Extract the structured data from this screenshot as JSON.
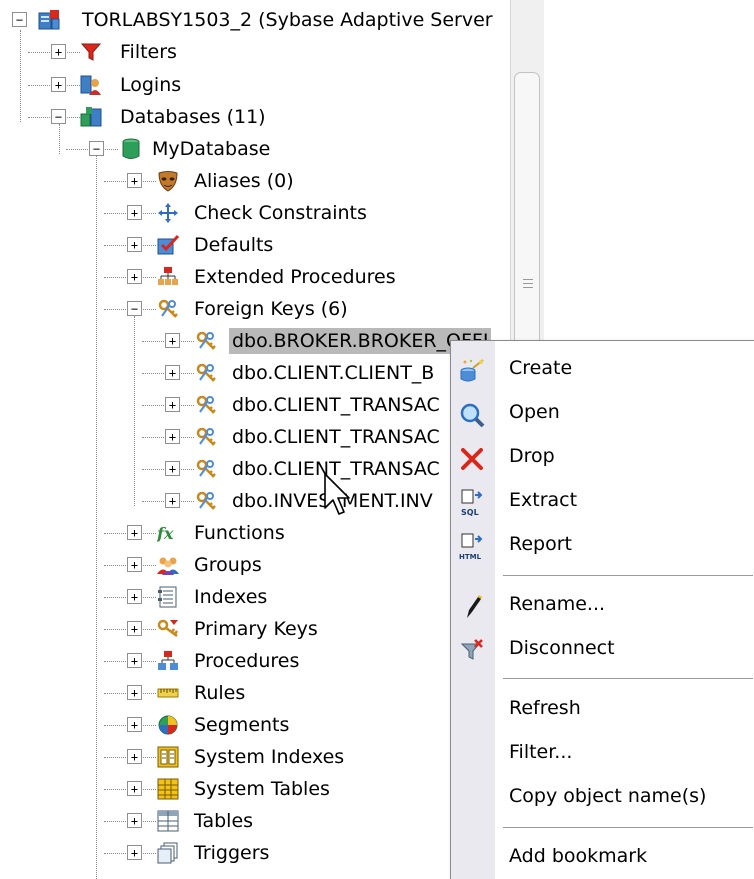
{
  "tree": {
    "server": "TORLABSY1503_2 (Sybase Adaptive Server",
    "filters": "Filters",
    "logins": "Logins",
    "databases": "Databases (11)",
    "mydatabase": "MyDatabase",
    "items": [
      {
        "label": "Aliases (0)",
        "icon": "mask-icon"
      },
      {
        "label": "Check Constraints",
        "icon": "move-arrows-icon"
      },
      {
        "label": "Defaults",
        "icon": "checkbox-icon"
      },
      {
        "label": "Extended Procedures",
        "icon": "hierarchy-icon"
      },
      {
        "label": "Foreign Keys (6)",
        "icon": "keys-icon"
      }
    ],
    "foreign_keys": [
      "dbo.BROKER.BROKER_OFFI",
      "dbo.CLIENT.CLIENT_B",
      "dbo.CLIENT_TRANSAC",
      "dbo.CLIENT_TRANSAC",
      "dbo.CLIENT_TRANSAC",
      "dbo.INVESTMENT.INV"
    ],
    "items_after": [
      {
        "label": "Functions",
        "icon": "function-icon"
      },
      {
        "label": "Groups",
        "icon": "group-icon"
      },
      {
        "label": "Indexes",
        "icon": "index-icon"
      },
      {
        "label": "Primary Keys",
        "icon": "primary-key-icon"
      },
      {
        "label": "Procedures",
        "icon": "procedure-icon"
      },
      {
        "label": "Rules",
        "icon": "ruler-icon"
      },
      {
        "label": "Segments",
        "icon": "segment-icon"
      },
      {
        "label": "System Indexes",
        "icon": "system-index-icon"
      },
      {
        "label": "System Tables",
        "icon": "system-table-icon"
      },
      {
        "label": "Tables",
        "icon": "table-icon"
      },
      {
        "label": "Triggers",
        "icon": "trigger-icon"
      }
    ]
  },
  "context_menu": {
    "items": [
      {
        "label": "Create",
        "icon": "create-icon"
      },
      {
        "label": "Open",
        "icon": "open-magnifier-icon"
      },
      {
        "label": "Drop",
        "icon": "drop-x-icon"
      },
      {
        "label": "Extract",
        "icon": "extract-sql-icon",
        "badge": "SQL"
      },
      {
        "label": "Report",
        "icon": "report-html-icon",
        "badge": "HTML"
      },
      {
        "label": "Rename...",
        "icon": "rename-pencil-icon"
      },
      {
        "label": "Disconnect",
        "icon": "disconnect-icon"
      },
      {
        "label": "Refresh",
        "icon": ""
      },
      {
        "label": "Filter...",
        "icon": ""
      },
      {
        "label": "Copy object name(s)",
        "icon": ""
      },
      {
        "label": "Add bookmark",
        "icon": ""
      }
    ]
  },
  "colors": {
    "selection": "#b9b9b9",
    "menu_strip": "#e9e9ef",
    "accent_red": "#d9271c",
    "accent_blue": "#2d6ec2"
  }
}
